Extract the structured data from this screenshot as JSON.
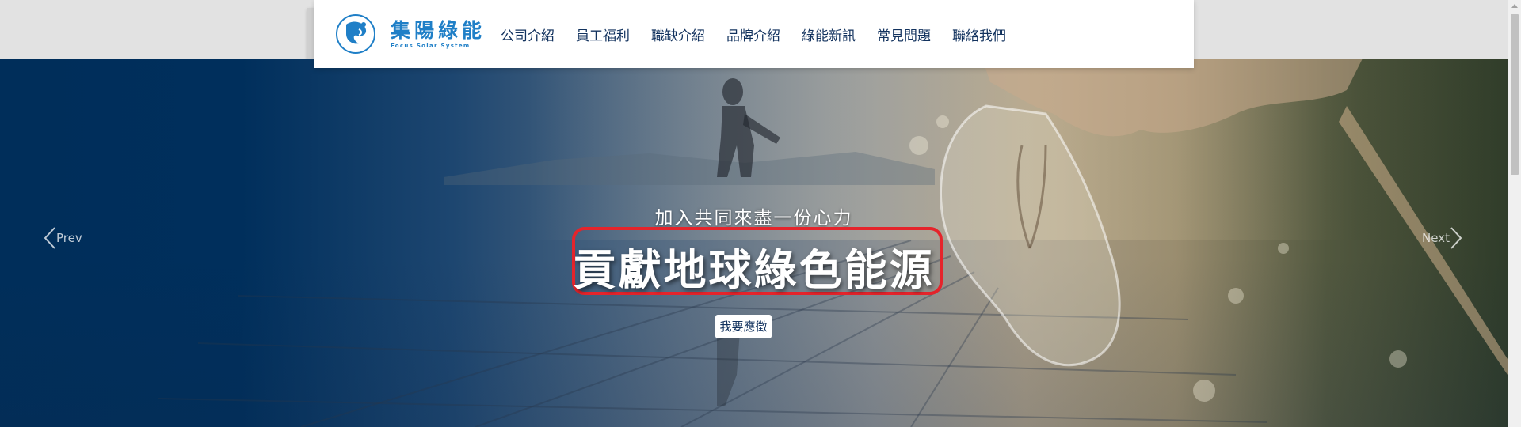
{
  "brand": {
    "name_cn": "集陽綠能",
    "name_en": "Focus Solar System"
  },
  "nav": {
    "items": [
      {
        "label": "公司介紹"
      },
      {
        "label": "員工福利"
      },
      {
        "label": "職缺介紹"
      },
      {
        "label": "品牌介紹"
      },
      {
        "label": "綠能新訊"
      },
      {
        "label": "常見問題"
      },
      {
        "label": "聯絡我們"
      }
    ]
  },
  "hero": {
    "subtitle": "加入共同來盡一份心力",
    "title": "貢獻地球綠色能源",
    "cta_label": "我要應徵",
    "prev_label": "Prev",
    "next_label": "Next",
    "highlight_color": "#e5242b"
  },
  "colors": {
    "brand_blue": "#1f7fc7",
    "nav_text": "#12325e",
    "hero_dark": "#002e5a"
  }
}
